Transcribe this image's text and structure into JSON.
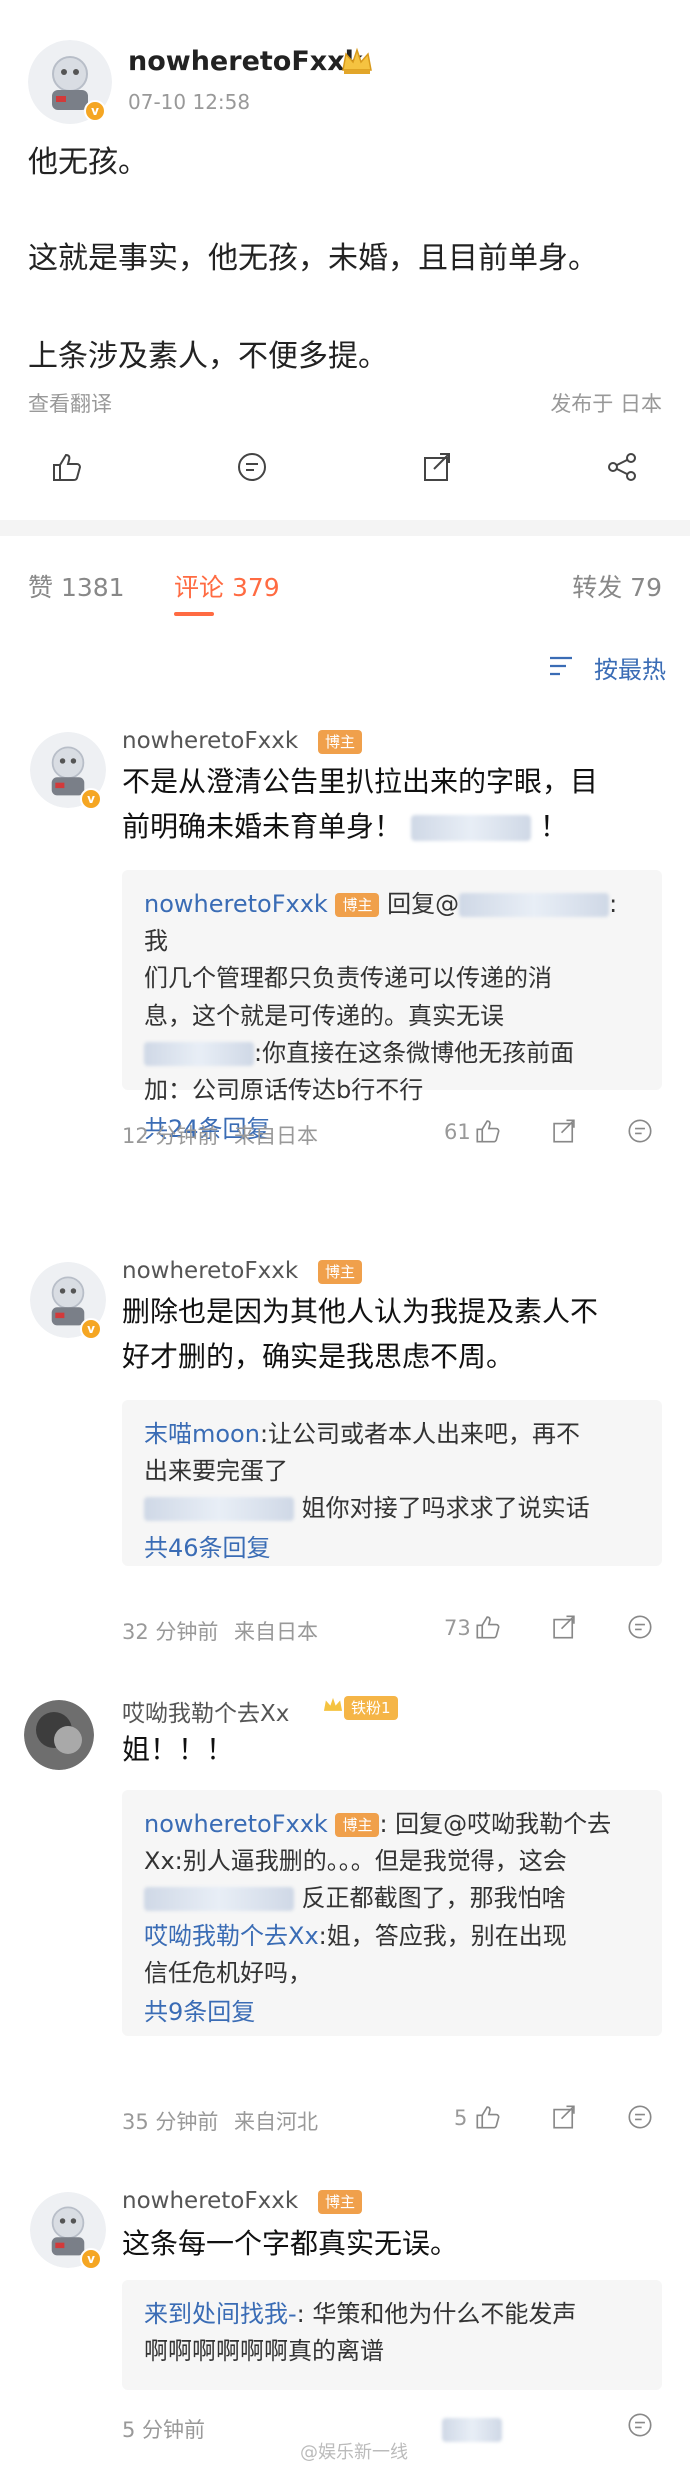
{
  "post": {
    "author": "nowheretoFxxk",
    "timestamp": "07-10 12:58",
    "lines": [
      "他无孩。",
      "这就是事实，他无孩，未婚，且目前单身。",
      "上条涉及素人，不便多提。"
    ],
    "translate": "查看翻译",
    "location": "发布于 日本"
  },
  "tabs": {
    "likes": "赞 1381",
    "comments": "评论 379",
    "reposts": "转发 79"
  },
  "sort_label": "按最热",
  "comments": [
    {
      "name": "nowheretoFxxk",
      "badge": "博主",
      "text1": "不是从澄清公告里扒拉出来的字眼，目",
      "text2": "前明确未婚未育单身！",
      "text2_end": "！",
      "reply_name": "nowheretoFxxk",
      "reply_badge": "博主",
      "reply_text_a": "回复@",
      "reply_text_b": ":我",
      "reply_line2": "们几个管理都只负责传递可以传递的消",
      "reply_line3": "息，这个就是可传递的。真实无误",
      "reply2_text": ":你直接在这条微博他无孩前面",
      "reply2_line2": "加：公司原话传达b行不行",
      "more": "共24条回复",
      "time": "12 分钟前",
      "source": "来自日本",
      "likes": "61"
    },
    {
      "name": "nowheretoFxxk",
      "badge": "博主",
      "text1": "删除也是因为其他人认为我提及素人不",
      "text2": "好才删的，确实是我思虑不周。",
      "reply_name": "末喵moon",
      "reply_text": ":让公司或者本人出来吧，再不",
      "reply_line2": "出来要完蛋了",
      "reply2_text": "姐你对接了吗求求了说实话",
      "more": "共46条回复",
      "time": "32 分钟前",
      "source": "来自日本",
      "likes": "73"
    },
    {
      "name": "哎呦我勒个去Xx",
      "badge": "铁粉1",
      "text1": "姐！！！",
      "reply_name": "nowheretoFxxk",
      "reply_badge": "博主",
      "reply_text": ": 回复@哎呦我勒个去",
      "reply_line2": "Xx:别人逼我删的。。。但是我觉得，这会",
      "reply_line3": "反正都截图了，那我怕啥",
      "reply2_name": "哎呦我勒个去Xx",
      "reply2_text": ":姐，答应我，别在出现",
      "reply2_line2": "信任危机好吗，",
      "more": "共9条回复",
      "time": "35 分钟前",
      "source": "来自河北",
      "likes": "5"
    },
    {
      "name": "nowheretoFxxk",
      "badge": "博主",
      "text1": "这条每一个字都真实无误。",
      "reply_name": "来到处间找我-",
      "reply_text": ": 华策和他为什么不能发声",
      "reply_line2": "啊啊啊啊啊啊真的离谱",
      "time": "5 分钟前"
    }
  ],
  "watermark": "@娱乐新一线"
}
